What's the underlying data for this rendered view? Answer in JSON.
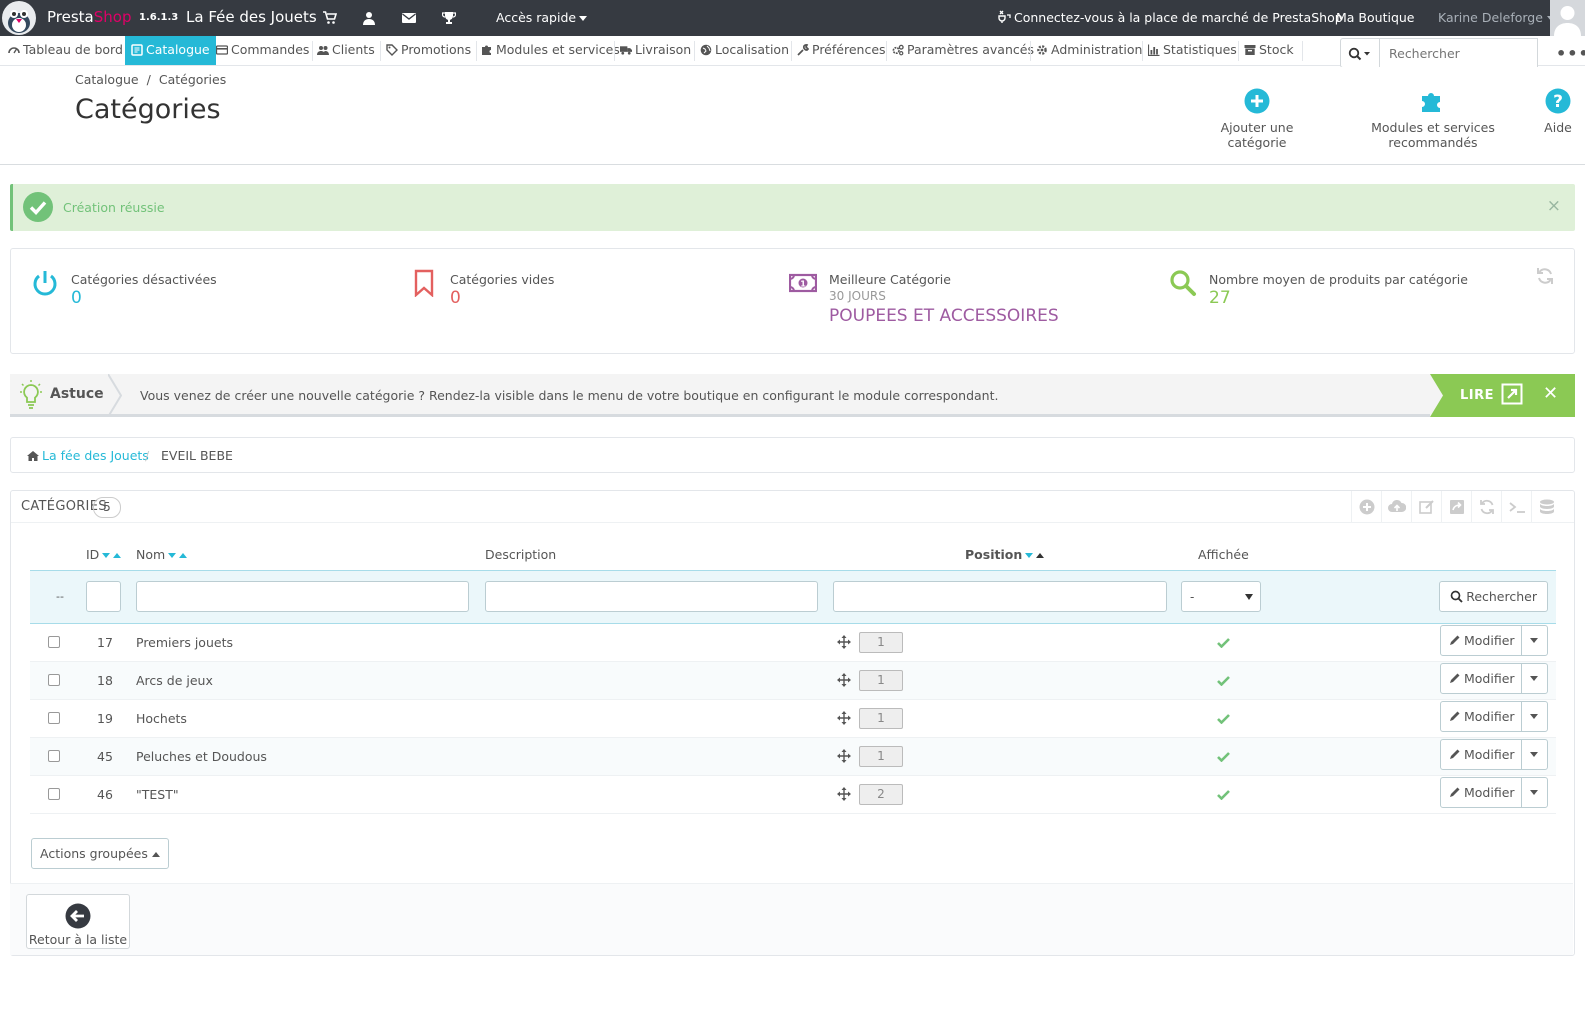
{
  "topbar": {
    "brand_presta": "Presta",
    "brand_shop": "Shop",
    "version": "1.6.1.3",
    "shop_name": "La Fée des Jouets",
    "quick_access": "Accès rapide",
    "marketplace": "Connectez-vous à la place de marché de PrestaShop",
    "my_shop": "Ma Boutique",
    "user_name": "Karine Deleforge",
    "icons": [
      "cart-icon",
      "user-icon",
      "envelope-icon",
      "trophy-icon"
    ]
  },
  "nav": {
    "items": [
      {
        "label": "Tableau de bord",
        "icon": "dashboard-icon"
      },
      {
        "label": "Catalogue",
        "icon": "book-icon",
        "active": true
      },
      {
        "label": "Commandes",
        "icon": "credit-card-icon"
      },
      {
        "label": "Clients",
        "icon": "users-icon"
      },
      {
        "label": "Promotions",
        "icon": "tags-icon"
      },
      {
        "label": "Modules et services",
        "icon": "puzzle-icon"
      },
      {
        "label": "Livraison",
        "icon": "truck-icon"
      },
      {
        "label": "Localisation",
        "icon": "globe-icon"
      },
      {
        "label": "Préférences",
        "icon": "wrench-icon"
      },
      {
        "label": "Paramètres avancés",
        "icon": "cogs-icon"
      },
      {
        "label": "Administration",
        "icon": "cog-icon"
      },
      {
        "label": "Statistiques",
        "icon": "bar-chart-icon"
      },
      {
        "label": "Stock",
        "icon": "archive-icon"
      }
    ],
    "search_placeholder": "Rechercher"
  },
  "header": {
    "breadcrumb": [
      "Catalogue",
      "Catégories"
    ],
    "title": "Catégories",
    "toolbar": [
      {
        "label": "Ajouter une catégorie",
        "icon": "plus-circle-icon"
      },
      {
        "label": "Modules et services recommandés",
        "icon": "puzzle-icon"
      },
      {
        "label": "Aide",
        "icon": "help-circle-icon"
      }
    ]
  },
  "alert": {
    "text": "Création réussie",
    "close": "×"
  },
  "kpis": [
    {
      "label": "Catégories désactivées",
      "value": "0",
      "icon": "power-icon",
      "color": "#25b9d7"
    },
    {
      "label": "Catégories vides",
      "value": "0",
      "icon": "bookmark-icon",
      "color": "#e3605f"
    },
    {
      "label": "Meilleure Catégorie",
      "sub": "30 JOURS",
      "value": "POUPEES ET ACCESSOIRES",
      "icon": "money-icon",
      "color": "#9e5ba1"
    },
    {
      "label": "Nombre moyen de produits par catégorie",
      "value": "27",
      "icon": "search-icon",
      "color": "#8bc954"
    }
  ],
  "tip": {
    "label": "Astuce",
    "text": "Vous venez de créer une nouvelle catégorie ? Rendez-la visible dans le menu de votre boutique en configurant le module correspondant.",
    "read": "LIRE",
    "close": "✕"
  },
  "category_path": {
    "home": "La fée des Jouets",
    "sep": "/",
    "current": "EVEIL BEBE"
  },
  "list": {
    "title": "CATÉGORIES",
    "count": "5",
    "columns": {
      "id": "ID",
      "name": "Nom",
      "description": "Description",
      "position": "Position",
      "displayed": "Affichée"
    },
    "filter": {
      "dash": "--",
      "select": "-",
      "search_button": "Rechercher"
    },
    "rows": [
      {
        "id": "17",
        "name": "Premiers jouets",
        "description": "",
        "position": "1"
      },
      {
        "id": "18",
        "name": "Arcs de jeux",
        "description": "",
        "position": "1"
      },
      {
        "id": "19",
        "name": "Hochets",
        "description": "",
        "position": "1"
      },
      {
        "id": "45",
        "name": "Peluches et Doudous",
        "description": "",
        "position": "1"
      },
      {
        "id": "46",
        "name": "\"TEST\"",
        "description": "",
        "position": "2"
      }
    ],
    "edit_label": "Modifier",
    "bulk_actions": "Actions groupées",
    "back_label": "Retour à la liste"
  },
  "colors": {
    "topbar": "#363a41",
    "accent": "#25b9d7",
    "success": "#72c279",
    "tip_green": "#8bc954",
    "brand_pink": "#df0067"
  }
}
